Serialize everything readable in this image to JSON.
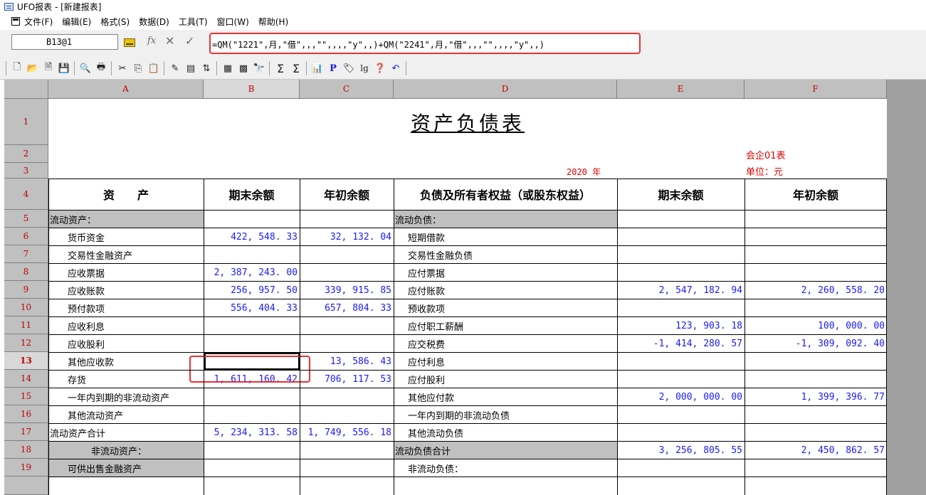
{
  "window": {
    "title": "UFO报表 - [新建报表]"
  },
  "menu": [
    "文件(F)",
    "编辑(E)",
    "格式(S)",
    "数据(D)",
    "工具(T)",
    "窗口(W)",
    "帮助(H)"
  ],
  "formula_bar": {
    "cell_ref": "B13@1",
    "fx_label": "fx",
    "cancel": "✕",
    "confirm": "✓",
    "formula": "=QM(\"1221\",月,\"借\",,,\"\",,,,\"y\",,)+QM(\"2241\",月,\"借\",,,\"\",,,,\"y\",,)"
  },
  "toolbar_glyphs": {
    "new": "🗋",
    "open": "📂",
    "blank": "🗎",
    "save": "💾",
    "preview": "🔍",
    "print": "🖶",
    "cut": "✂",
    "copy": "⎘",
    "paste": "📋",
    "format": "✎",
    "fill": "▤",
    "sort": "⇅",
    "grid1": "▦",
    "grid2": "▩",
    "find": "🔭",
    "sum": "Σ",
    "sum2": "Σ",
    "chart": "📊",
    "p": "P",
    "tag": "🏷",
    "log": "lg",
    "help": "❓",
    "undo": "↶"
  },
  "sheet": {
    "columns": [
      "A",
      "B",
      "C",
      "D",
      "E",
      "F"
    ],
    "rows": [
      "1",
      "2",
      "3",
      "4",
      "5",
      "6",
      "7",
      "8",
      "9",
      "10",
      "11",
      "12",
      "13",
      "14",
      "15",
      "16",
      "17",
      "18",
      "19"
    ],
    "title": "资产负债表",
    "form_no": "会企01表",
    "year_text": "2020 年",
    "unit": "单位：元",
    "header": {
      "a": "资　　产",
      "b": "期末余额",
      "c": "年初余额",
      "d": "负债及所有者权益（或股东权益）",
      "e": "期末余额",
      "f": "年初余额"
    },
    "body": [
      {
        "a": "流动资产：",
        "b": "",
        "c": "",
        "d": "流动负债：",
        "e": "",
        "f": ""
      },
      {
        "a": "货币资金",
        "b": "422, 548. 33",
        "c": "32, 132. 04",
        "d": "短期借款",
        "e": "",
        "f": ""
      },
      {
        "a": "交易性金融资产",
        "b": "",
        "c": "",
        "d": "交易性金融负债",
        "e": "",
        "f": ""
      },
      {
        "a": "应收票据",
        "b": "2, 387, 243. 00",
        "c": "",
        "d": "应付票据",
        "e": "",
        "f": ""
      },
      {
        "a": "应收账款",
        "b": "256, 957. 50",
        "c": "339, 915. 85",
        "d": "应付账款",
        "e": "2, 547, 182. 94",
        "f": "2, 260, 558. 20"
      },
      {
        "a": "预付款项",
        "b": "556, 404. 33",
        "c": "657, 804. 33",
        "d": "预收款项",
        "e": "",
        "f": ""
      },
      {
        "a": "应收利息",
        "b": "",
        "c": "",
        "d": "应付职工薪酬",
        "e": "123, 903. 18",
        "f": "100, 000. 00"
      },
      {
        "a": "应收股利",
        "b": "",
        "c": "",
        "d": "应交税费",
        "e": "-1, 414, 280. 57",
        "f": "-1, 309, 092. 40"
      },
      {
        "a": "其他应收款",
        "b": "",
        "c": "13, 586. 43",
        "d": "应付利息",
        "e": "",
        "f": ""
      },
      {
        "a": "存货",
        "b": "1, 611, 160. 42",
        "c": "706, 117. 53",
        "d": "应付股利",
        "e": "",
        "f": ""
      },
      {
        "a": "一年内到期的非流动资产",
        "b": "",
        "c": "",
        "d": "其他应付款",
        "e": "2, 000, 000. 00",
        "f": "1, 399, 396. 77"
      },
      {
        "a": "其他流动资产",
        "b": "",
        "c": "",
        "d": "一年内到期的非流动负债",
        "e": "",
        "f": ""
      },
      {
        "a": "流动资产合计",
        "b": "5, 234, 313. 58",
        "c": "1, 749, 556. 18",
        "d": "其他流动负债",
        "e": "",
        "f": ""
      },
      {
        "a": "非流动资产：",
        "b": "",
        "c": "",
        "d": "流动负债合计",
        "e": "3, 256, 805. 55",
        "f": "2, 450, 862. 57"
      },
      {
        "a": "可供出售金融资产",
        "b": "",
        "c": "",
        "d": "非流动负债：",
        "e": "",
        "f": ""
      }
    ]
  }
}
